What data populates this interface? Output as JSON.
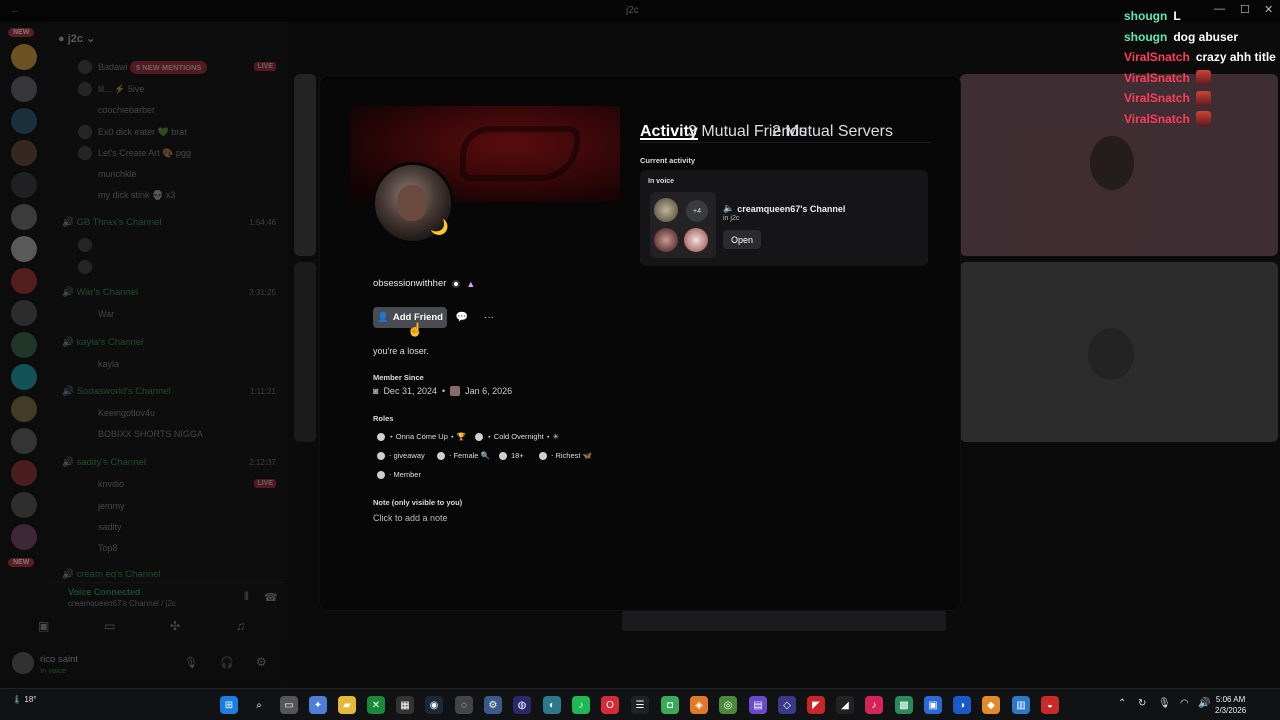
{
  "window": {
    "title": "j2c"
  },
  "server": {
    "name": "j2c",
    "new_badge": "NEW",
    "mentions": "5 NEW MENTIONS"
  },
  "sidebar": {
    "rows": [
      {
        "text": "Badawi",
        "badge": "LIVE"
      },
      {
        "text": "lil... ⚡ 5ive"
      },
      {
        "text": "coochiebarber"
      },
      {
        "text": "Ex0 dick eater 💚 brat"
      },
      {
        "text": "Let's Create Art 🎨 pgg"
      },
      {
        "text": "munchkle"
      },
      {
        "text": "my dick stink 💀 x3"
      }
    ],
    "channels": [
      {
        "name": "GB Thrax's Channel",
        "time": "1:54:46"
      },
      {
        "name": "War's Channel",
        "time": "3:31:25"
      },
      {
        "name": "kayla's Channel",
        "time": ""
      },
      {
        "name": "Sodasworld's Channel",
        "time": "1:11:21"
      },
      {
        "name": "sadity's Channel",
        "time": "2:12:37"
      },
      {
        "name": "cream eq's Channel",
        "time": ""
      }
    ],
    "members": [
      "War",
      "kayla",
      "Keeingotlov4u",
      "BOBIXX SHORTS NIGGA",
      "knvdio",
      "jemmy",
      "sadity",
      "Top8"
    ],
    "voice": {
      "status": "Voice Connected",
      "detail": "creamqueen67's Channel / j2c"
    },
    "user": {
      "name": "rico saint",
      "status": "In voice"
    }
  },
  "chat": [
    {
      "name": "shougn",
      "text": "L",
      "color": "green"
    },
    {
      "name": "shougn",
      "text": "dog abuser",
      "color": "green"
    },
    {
      "name": "ViralSnatch",
      "text": "crazy ahh title",
      "color": "red"
    },
    {
      "name": "ViralSnatch",
      "text": "",
      "color": "red"
    },
    {
      "name": "ViralSnatch",
      "text": "",
      "color": "red"
    },
    {
      "name": "ViralSnatch",
      "text": "",
      "color": "red"
    }
  ],
  "profile": {
    "username": "obsessionwithher",
    "add_friend": "Add Friend",
    "bio": "you're a loser.",
    "member_since_label": "Member Since",
    "discord_date": "Dec 31, 2024",
    "server_date": "Jan 6, 2026",
    "roles_label": "Roles",
    "roles": [
      {
        "label": "⋆ Onna Come Up ⋆ 🏆"
      },
      {
        "label": "⋆ Cold Overnight ⋆ ✳"
      },
      {
        "label": "⋅ giveaway"
      },
      {
        "label": "⋅ Female 🔍"
      },
      {
        "label": "18+"
      },
      {
        "label": "⋅ Richest 🦋"
      },
      {
        "label": "⋅ Member"
      }
    ],
    "note_label": "Note (only visible to you)",
    "note_placeholder": "Click to add a note"
  },
  "tabs": {
    "activity": "Activity",
    "mutual_friends": "3 Mutual Friends",
    "mutual_servers": "2 Mutual Servers"
  },
  "activity": {
    "current_label": "Current activity",
    "in_voice": "In voice",
    "more_count": "+4",
    "channel_name": "creamqueen67's Channel",
    "channel_server": "in j2c",
    "open": "Open"
  },
  "taskbar": {
    "temp": "18°",
    "time": "5:06 AM",
    "date": "2/3/2026"
  },
  "colors": {
    "chat_green": "#5ee8b6",
    "chat_red": "#ff3d58",
    "live": "#d63342",
    "voice_green": "#37c05e"
  }
}
